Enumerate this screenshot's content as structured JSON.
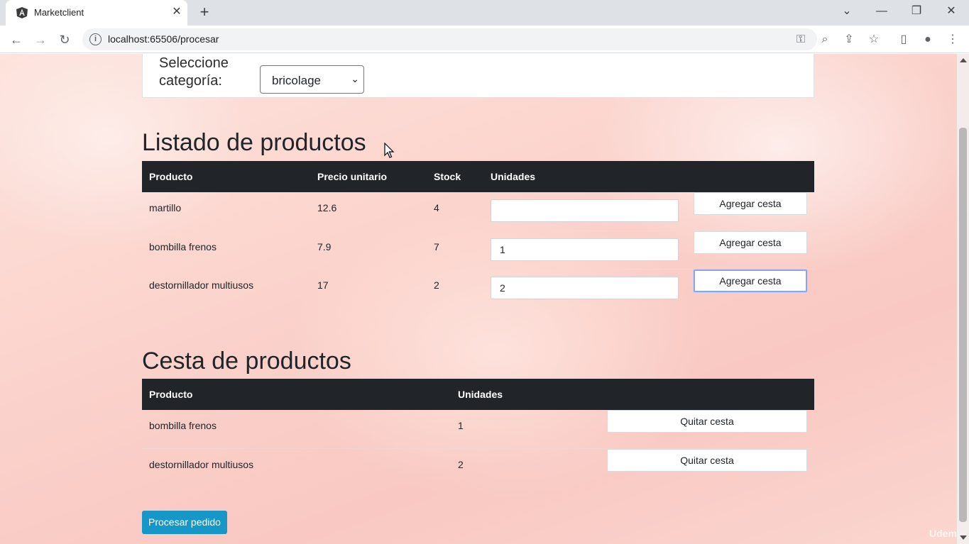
{
  "browser": {
    "tab_title": "Marketclient",
    "url": "localhost:65506/procesar"
  },
  "category": {
    "label": "Seleccione categoría:",
    "selected": "bricolage"
  },
  "products": {
    "heading": "Listado de productos",
    "columns": [
      "Producto",
      "Precio unitario",
      "Stock",
      "Unidades"
    ],
    "rows": [
      {
        "name": "martillo",
        "price": "12.6",
        "stock": "4",
        "units": "",
        "button": "Agregar cesta"
      },
      {
        "name": "bombilla frenos",
        "price": "7.9",
        "stock": "7",
        "units": "1",
        "button": "Agregar cesta"
      },
      {
        "name": "destornillador multiusos",
        "price": "17",
        "stock": "2",
        "units": "2",
        "button": "Agregar cesta"
      }
    ]
  },
  "basket": {
    "heading": "Cesta de productos",
    "columns": [
      "Producto",
      "Unidades"
    ],
    "rows": [
      {
        "name": "bombilla frenos",
        "units": "1",
        "button": "Quitar cesta"
      },
      {
        "name": "destornillador multiusos",
        "units": "2",
        "button": "Quitar cesta"
      }
    ]
  },
  "process_button": "Procesar pedido",
  "watermark": "Udemy",
  "colors": {
    "table_header": "#212529",
    "primary": "#1597c8"
  }
}
